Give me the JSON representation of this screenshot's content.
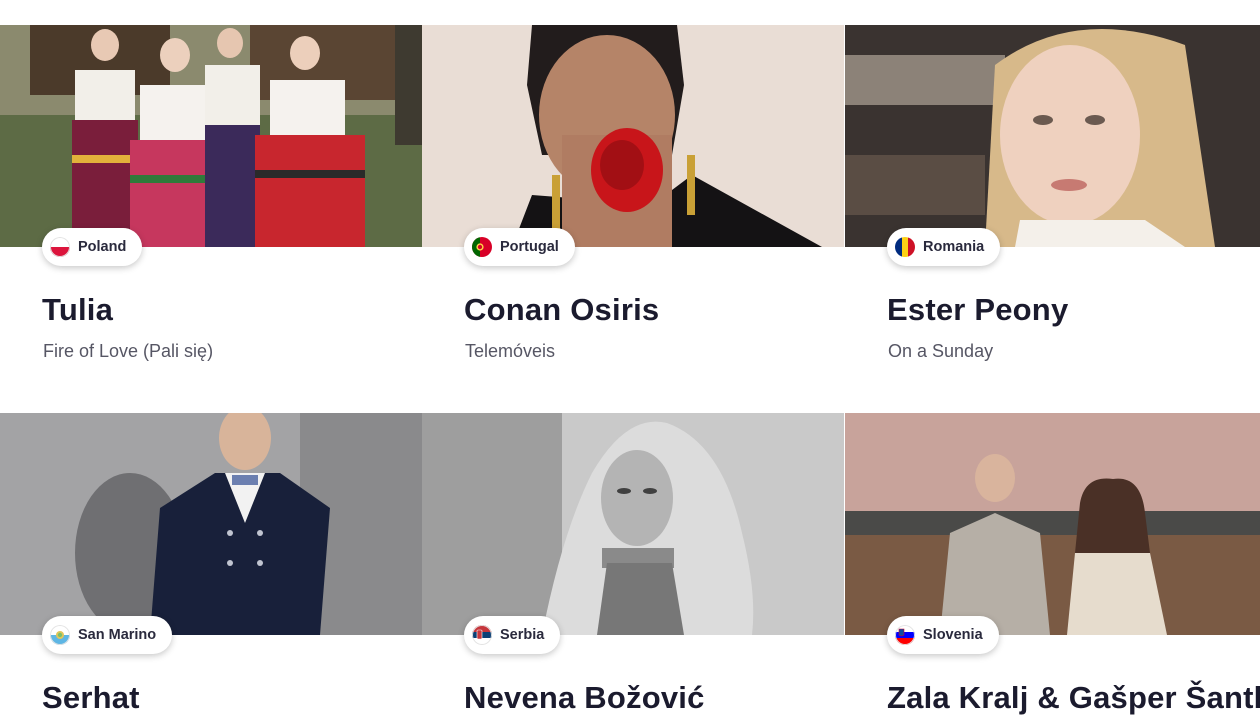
{
  "entries": [
    {
      "country": "Poland",
      "artist": "Tulia",
      "song": "Fire of Love (Pali się)"
    },
    {
      "country": "Portugal",
      "artist": "Conan Osiris",
      "song": "Telemóveis"
    },
    {
      "country": "Romania",
      "artist": "Ester Peony",
      "song": "On a Sunday"
    },
    {
      "country": "San Marino",
      "artist": "Serhat",
      "song": ""
    },
    {
      "country": "Serbia",
      "artist": "Nevena Božović",
      "song": ""
    },
    {
      "country": "Slovenia",
      "artist": "Zala Kralj & Gašper Šantl",
      "song": ""
    }
  ],
  "colors": {
    "text_primary": "#1b1b2e",
    "text_secondary": "#565664",
    "badge_bg": "#ffffff"
  }
}
